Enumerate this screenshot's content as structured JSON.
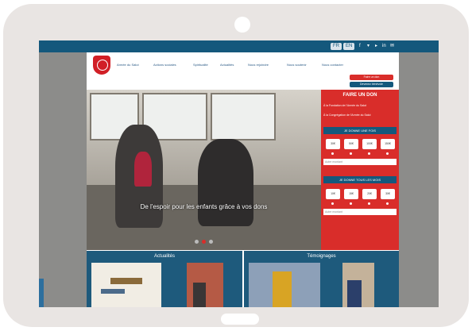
{
  "top_bar": {
    "lang_fr": "FR",
    "lang_en": "EN",
    "social_icons": [
      "facebook-icon",
      "twitter-icon",
      "youtube-icon",
      "linkedin-icon",
      "mail-icon"
    ]
  },
  "nav": {
    "items": [
      "Armée du Salut",
      "Actions sociales",
      "Spiritualité",
      "Actualités",
      "Nous rejoindre",
      "Nous soutenir",
      "Nous contacter"
    ]
  },
  "header_buttons": {
    "donate": "Faire un don",
    "volunteer": "Devenez bénévole"
  },
  "hero": {
    "caption": "De l'espoir pour les enfants grâce à vos dons",
    "slides": 3,
    "active_slide": 2
  },
  "donation": {
    "title": "FAIRE UN DON",
    "option_1": "À la Fondation de l'Armée du Salut",
    "option_2": "À la Congrégation de l'Armée du Salut",
    "once_label": "JE DONNE UNE FOIS",
    "monthly_label": "JE DONNE TOUS LES MOIS",
    "once_amounts": [
      "30€",
      "50€",
      "100€",
      "150€"
    ],
    "monthly_amounts": [
      "10€",
      "15€",
      "20€",
      "30€"
    ],
    "other_placeholder": "Autre montant"
  },
  "sections": {
    "news_title": "Actualités",
    "testimonials_title": "Témoignages"
  },
  "colors": {
    "brand_red": "#d92d2a",
    "brand_blue": "#14587c"
  }
}
